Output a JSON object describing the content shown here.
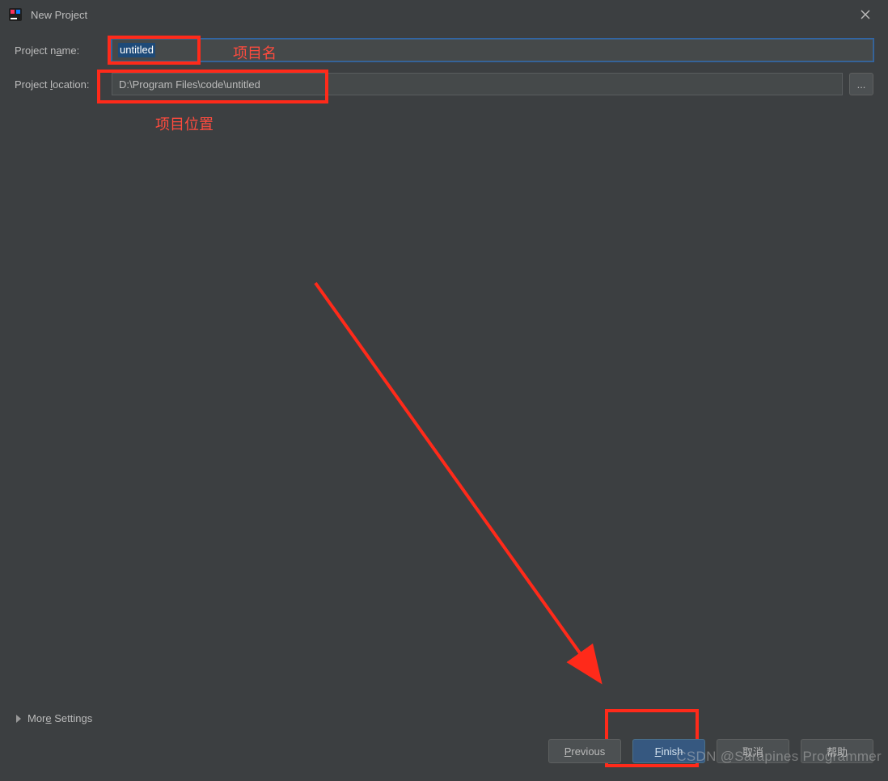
{
  "window": {
    "title": "New Project"
  },
  "fields": {
    "name_label_prefix": "Project n",
    "name_label_ul": "a",
    "name_label_suffix": "me:",
    "name_value": "untitled",
    "loc_label_prefix": "Project ",
    "loc_label_ul": "l",
    "loc_label_suffix": "ocation:",
    "loc_value": "D:\\Program Files\\code\\untitled",
    "browse_label": "..."
  },
  "annotations": {
    "name": "项目名",
    "location": "项目位置"
  },
  "more": {
    "prefix": "Mor",
    "ul": "e",
    "suffix": " Settings"
  },
  "buttons": {
    "previous_ul": "P",
    "previous_rest": "revious",
    "finish_ul": "F",
    "finish_rest": "inish",
    "cancel": "取消",
    "help": "帮助"
  },
  "watermark": "CSDN @Sarapines Programmer"
}
